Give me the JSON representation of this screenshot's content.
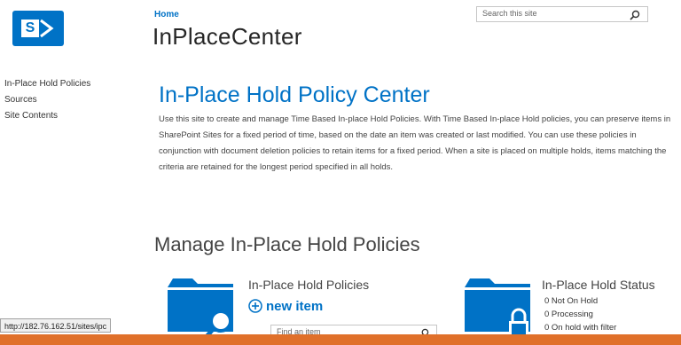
{
  "header": {
    "breadcrumb": "Home",
    "site_title": "InPlaceCenter",
    "search_placeholder": "Search this site"
  },
  "logo": {
    "letter": "S"
  },
  "sidebar": {
    "items": [
      {
        "label": "In-Place Hold Policies"
      },
      {
        "label": "Sources"
      },
      {
        "label": "Site Contents"
      }
    ]
  },
  "main": {
    "heading": "In-Place Hold Policy Center",
    "description": "Use this site to create and manage Time Based In-place Hold Policies. With Time Based In-place Hold policies, you can preserve items in SharePoint Sites for a fixed period of time, based on the date an item was created or last modified. You can use these policies in conjunction with document deletion policies to retain items for a fixed period. When a site is placed on multiple holds, items matching the criteria are retained for the longest period specified in all holds.",
    "section_heading": "Manage In-Place Hold Policies",
    "policies_card": {
      "title": "In-Place Hold Policies",
      "new_item_label": "new item",
      "find_placeholder": "Find an item"
    },
    "status_card": {
      "title": "In-Place Hold Status",
      "items": [
        {
          "label": "0 Not On Hold"
        },
        {
          "label": "0 Processing"
        },
        {
          "label": "0 On hold with filter"
        }
      ]
    }
  },
  "browser": {
    "status_url": "http://182.76.162.51/sites/ipc"
  },
  "colors": {
    "accent": "#0072c6",
    "taskbar": "#e0702a"
  }
}
